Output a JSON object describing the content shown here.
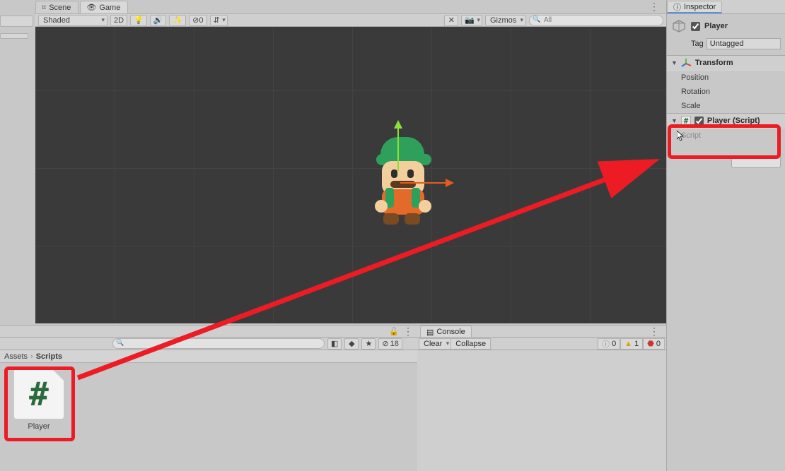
{
  "tabs": {
    "scene": "Scene",
    "game": "Game"
  },
  "sceneToolbar": {
    "shading": "Shaded",
    "mode2d": "2D",
    "visibleCount": "0",
    "gizmos": "Gizmos",
    "searchPlaceholder": "All"
  },
  "project": {
    "searchPlaceholder": "",
    "hiddenCount": "18",
    "breadcrumb": {
      "root": "Assets",
      "folder": "Scripts"
    },
    "asset": {
      "label": "Player",
      "glyph": "#"
    }
  },
  "console": {
    "tab": "Console",
    "clear": "Clear",
    "collapse": "Collapse",
    "info": "0",
    "warn": "1",
    "err": "0"
  },
  "inspector": {
    "tab": "Inspector",
    "goName": "Player",
    "tagLabel": "Tag",
    "tagValue": "Untagged",
    "transform": {
      "title": "Transform",
      "position": "Position",
      "rotation": "Rotation",
      "scale": "Scale"
    },
    "script": {
      "title": "Player (Script)",
      "fieldLabel": "Script"
    }
  }
}
